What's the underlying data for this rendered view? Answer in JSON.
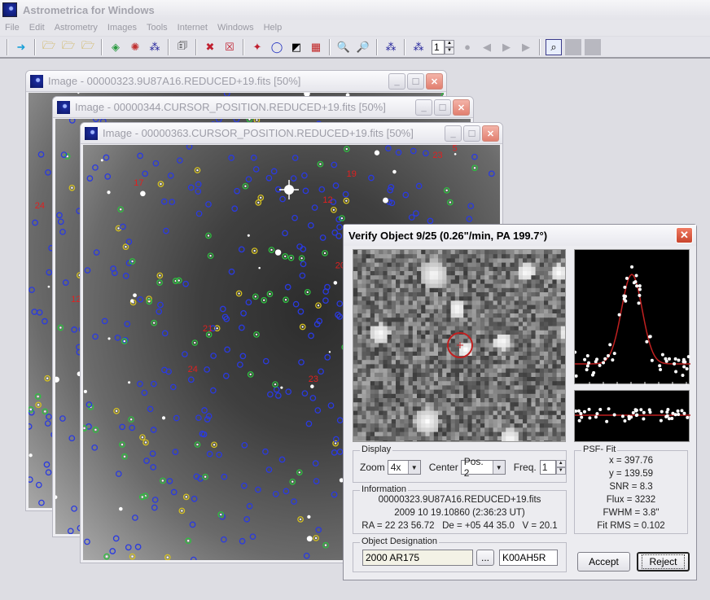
{
  "app": {
    "title": "Astrometrica for Windows",
    "menu": [
      "File",
      "Edit",
      "Astrometry",
      "Images",
      "Tools",
      "Internet",
      "Windows",
      "Help"
    ]
  },
  "toolbar": {
    "buttons": [
      {
        "name": "data-reduction-icon",
        "glyph": "➜"
      },
      {
        "name": "load-images-icon",
        "glyph": "🗁"
      },
      {
        "name": "load-dark-icon",
        "glyph": "🗁"
      },
      {
        "name": "load-flat-icon",
        "glyph": "🗁"
      },
      {
        "name": "start-reduction-icon",
        "glyph": "◈"
      },
      {
        "name": "settings-reduction-icon",
        "glyph": "✺"
      },
      {
        "name": "moving-object-detection-icon",
        "glyph": "⁂"
      },
      {
        "name": "report-icon",
        "glyph": "🗊"
      },
      {
        "name": "delete-image-icon",
        "glyph": "✖"
      },
      {
        "name": "close-image-icon",
        "glyph": "☒"
      },
      {
        "name": "blink-icon",
        "glyph": "✦"
      },
      {
        "name": "object-circle-icon",
        "glyph": "◯"
      },
      {
        "name": "invert-icon",
        "glyph": "◩"
      },
      {
        "name": "colorize-icon",
        "glyph": "▦"
      },
      {
        "name": "zoom-in-icon",
        "glyph": "🔍"
      },
      {
        "name": "zoom-out-icon",
        "glyph": "🔎"
      },
      {
        "name": "star-catalog-icon",
        "glyph": "⁂"
      },
      {
        "name": "track-and-stack-icon",
        "glyph": "⁂"
      }
    ],
    "frame_number": "1",
    "playback": [
      "record",
      "previous",
      "play",
      "next"
    ]
  },
  "windows": [
    {
      "title": "Image - 00000323.9U87A16.REDUCED+19.fits [50%]"
    },
    {
      "title": "Image - 00000344.CURSOR_POSITION.REDUCED+19.fits [50%]"
    },
    {
      "title": "Image - 00000363.CURSOR_POSITION.REDUCED+19.fits [50%]"
    }
  ],
  "dialog": {
    "title": "Verify Object 9/25 (0.26\"/min, PA 199.7°)",
    "display": {
      "legend": "Display",
      "zoom_label": "Zoom",
      "zoom_value": "4x",
      "center_label": "Center",
      "center_value": "Pos. 2",
      "freq_label": "Freq.",
      "freq_value": "1"
    },
    "information": {
      "legend": "Information",
      "file": "00000323.9U87A16.REDUCED+19.fits",
      "date": "2009 10 19.10860 (2:36:23 UT)",
      "coords": "RA = 22 23 56.72   De = +05 44 35.0   V = 20.1"
    },
    "psf": {
      "legend": "PSF- Fit",
      "lines": [
        "x = 397.76",
        "y = 139.59",
        "SNR = 8.3",
        "Flux = 3232",
        "FWHM = 3.8\"",
        "Fit RMS = 0.102"
      ]
    },
    "designation": {
      "legend": "Object Designation",
      "name_value": "2000 AR175",
      "browse_label": "...",
      "packed_value": "K00AH5R"
    },
    "accept_label": "Accept",
    "reject_label": "Reject"
  },
  "colors": {
    "catalog_star": "#2a3ae0",
    "matched_star": "#2ec040",
    "reference_star": "#d4c020",
    "moving_object": "#e02020",
    "psf_curve": "#c02020"
  }
}
